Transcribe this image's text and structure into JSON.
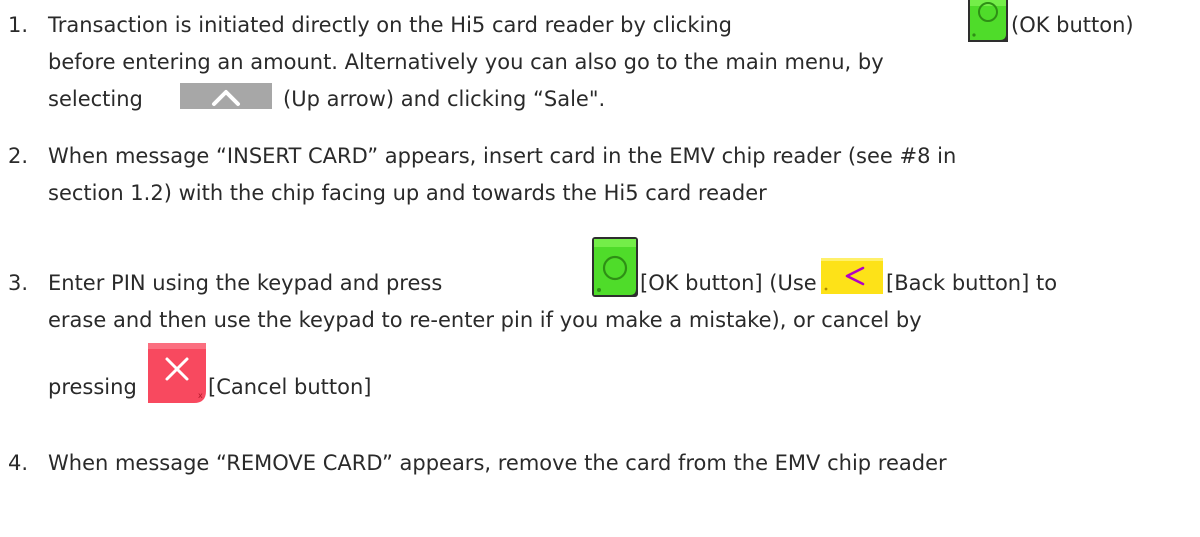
{
  "steps": [
    {
      "number": "1.",
      "line1_a": "Transaction is initiated directly on the Hi5 card reader by clicking",
      "line1_b": "(OK button)",
      "line2": "before entering an amount. Alternatively you can also go to the main menu, by",
      "line3_a": "selecting",
      "line3_b": "(Up arrow) and clicking “Sale\"."
    },
    {
      "number": "2.",
      "line1": "When message “INSERT CARD” appears, insert card in the EMV chip reader (see #8 in",
      "line2": "section 1.2)  with the chip facing up and towards the Hi5 card reader"
    },
    {
      "number": "3.",
      "line1_a": "Enter PIN using the keypad and press",
      "line1_b": "[OK button] (Use",
      "line1_c": "[Back button] to",
      "line2": "erase and then use the keypad to re-enter pin if you make a mistake), or cancel by",
      "line3_a": "pressing",
      "line3_b": "[Cancel button]"
    },
    {
      "number": "4.",
      "line1": "When message “REMOVE CARD” appears, remove the card from the EMV chip reader"
    }
  ],
  "icons": {
    "ok_button": "ok-button-icon",
    "up_arrow": "up-arrow-icon",
    "back_button": "back-button-icon",
    "cancel_button": "cancel-button-icon"
  },
  "colors": {
    "ok_green": "#4fdc2a",
    "up_gray": "#a7a7a7",
    "back_yellow": "#fde218",
    "cancel_red": "#f8495f"
  }
}
